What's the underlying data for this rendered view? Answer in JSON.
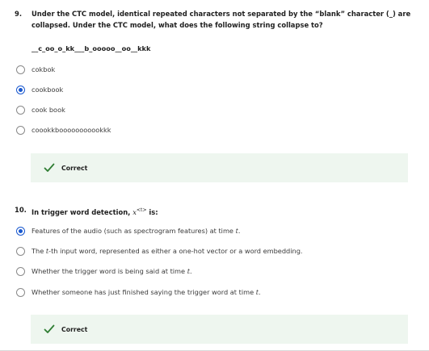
{
  "q9": {
    "number": "9.",
    "text": "Under the CTC model, identical repeated characters not separated by the “blank” character (_) are collapsed. Under the CTC model, what does the following string collapse to?",
    "sequence": "__c_oo_o_kk___b_ooooo__oo__kkk",
    "options": [
      {
        "label": "cokbok",
        "selected": false
      },
      {
        "label": "cookbook",
        "selected": true
      },
      {
        "label": "cook book",
        "selected": false
      },
      {
        "label": "coookkbooooooooookkk",
        "selected": false
      }
    ],
    "feedback": "Correct"
  },
  "q10": {
    "number": "10.",
    "text_before": "In trigger word detection, ",
    "math_var": "x",
    "math_sup": "<t>",
    "text_after": " is:",
    "options": [
      {
        "before": "Features of the audio (such as spectrogram features) at time ",
        "var": "t",
        "after": ".",
        "selected": true
      },
      {
        "before": "The ",
        "var": "t",
        "after": "-th input word, represented as either a one-hot vector or a word embedding.",
        "selected": false
      },
      {
        "before": "Whether the trigger word is being said at time ",
        "var": "t",
        "after": ".",
        "selected": false
      },
      {
        "before": "Whether someone has just finished saying the trigger word at time ",
        "var": "t",
        "after": ".",
        "selected": false
      }
    ],
    "feedback": "Correct"
  },
  "colors": {
    "accent": "#1a59cf",
    "correct_green": "#2e7d32",
    "feedback_bg": "#eef6ef"
  },
  "icons": {
    "feedback": "check-icon"
  }
}
